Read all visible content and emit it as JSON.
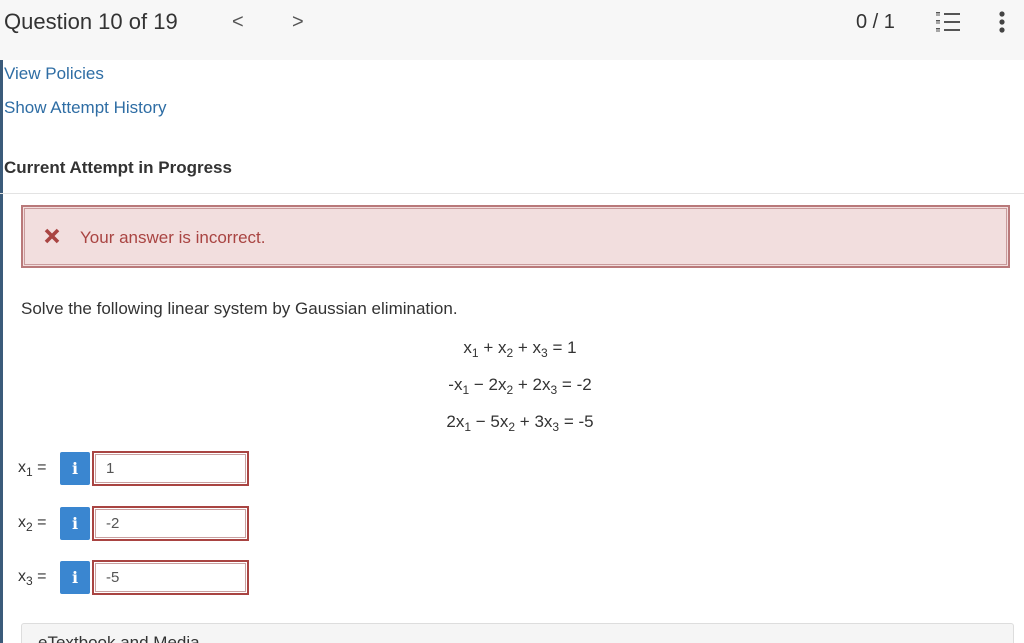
{
  "header": {
    "question_counter": "Question 10 of 19",
    "prev_icon": "chevron-left-icon",
    "next_icon": "chevron-right-icon",
    "prev_glyph": "<",
    "next_glyph": ">",
    "score": "0 / 1",
    "list_icon": "numbered-list-icon",
    "more_icon": "vertical-dots-icon"
  },
  "links": {
    "view_policies": "View Policies",
    "show_attempt_history": "Show Attempt History"
  },
  "attempt": {
    "title": "Current Attempt in Progress"
  },
  "feedback": {
    "icon": "x-mark-icon",
    "message": "Your answer is incorrect.",
    "color": "#a94442",
    "background": "#f2dede"
  },
  "question": {
    "prompt": "Solve the following linear system by Gaussian elimination.",
    "equations": [
      {
        "lhs": [
          {
            "sign": "",
            "coef": "",
            "var": "x",
            "sub": "1"
          },
          {
            "sign": "+",
            "coef": "",
            "var": "x",
            "sub": "2"
          },
          {
            "sign": "+",
            "coef": "",
            "var": "x",
            "sub": "3"
          }
        ],
        "rhs": "1"
      },
      {
        "lhs": [
          {
            "sign": "-",
            "coef": "",
            "var": "x",
            "sub": "1"
          },
          {
            "sign": "−",
            "coef": "2",
            "var": "x",
            "sub": "2"
          },
          {
            "sign": "+",
            "coef": "2",
            "var": "x",
            "sub": "3"
          }
        ],
        "rhs": "-2"
      },
      {
        "lhs": [
          {
            "sign": "",
            "coef": "2",
            "var": "x",
            "sub": "1"
          },
          {
            "sign": "−",
            "coef": "5",
            "var": "x",
            "sub": "2"
          },
          {
            "sign": "+",
            "coef": "3",
            "var": "x",
            "sub": "3"
          }
        ],
        "rhs": "-5"
      }
    ]
  },
  "answers": [
    {
      "var": "x",
      "sub": "1",
      "eq": "=",
      "info_glyph": "i",
      "value": "1"
    },
    {
      "var": "x",
      "sub": "2",
      "eq": "=",
      "info_glyph": "i",
      "value": "-2"
    },
    {
      "var": "x",
      "sub": "3",
      "eq": "=",
      "info_glyph": "i",
      "value": "-5"
    }
  ],
  "resources": {
    "etextbook_label": "eTextbook and Media"
  },
  "colors": {
    "link": "#2e6da4",
    "info_button": "#3a86d0",
    "error_border": "#a94442"
  }
}
